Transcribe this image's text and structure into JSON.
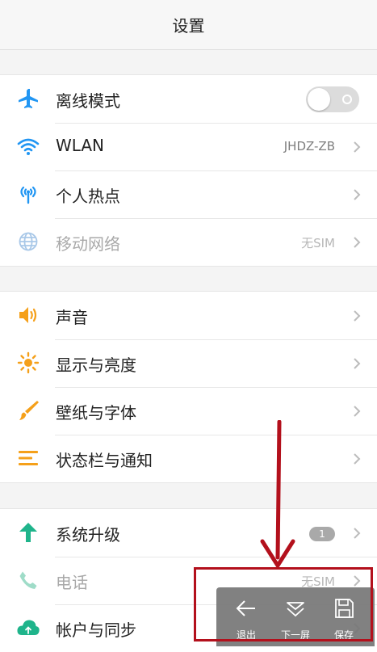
{
  "header": {
    "title": "设置"
  },
  "group1": [
    {
      "label": "离线模式",
      "icon": "airplane-icon",
      "control": "toggle",
      "toggle_on": false
    },
    {
      "label": "WLAN",
      "icon": "wifi-icon",
      "value": "JHDZ-ZB"
    },
    {
      "label": "个人热点",
      "icon": "hotspot-icon"
    },
    {
      "label": "移动网络",
      "icon": "globe-icon",
      "value": "无SIM",
      "disabled": true
    }
  ],
  "group2": [
    {
      "label": "声音",
      "icon": "speaker-icon"
    },
    {
      "label": "显示与亮度",
      "icon": "sun-icon"
    },
    {
      "label": "壁纸与字体",
      "icon": "brush-icon"
    },
    {
      "label": "状态栏与通知",
      "icon": "statusbar-icon"
    }
  ],
  "group3": [
    {
      "label": "系统升级",
      "icon": "arrow-up-icon",
      "badge": "1"
    },
    {
      "label": "电话",
      "icon": "phone-icon",
      "value": "无SIM",
      "disabled": true
    },
    {
      "label": "帐户与同步",
      "icon": "cloud-sync-icon"
    }
  ],
  "floating_toolbar": {
    "exit": "退出",
    "next_screen": "下一屏",
    "save": "保存"
  },
  "colors": {
    "blue": "#2196f3",
    "orange": "#f5a01a",
    "green": "#1fb48b",
    "annotation_red": "#b3101c"
  }
}
